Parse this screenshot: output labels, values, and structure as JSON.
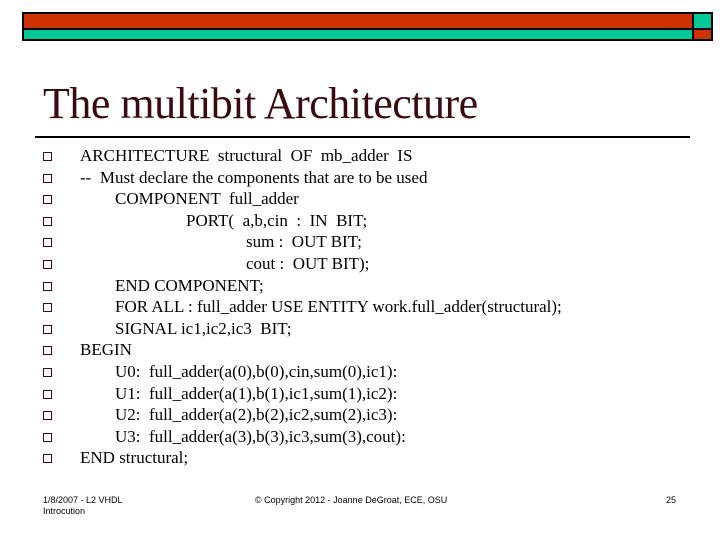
{
  "colors": {
    "accent_red": "#cc3300",
    "accent_teal": "#00c896",
    "title_color": "#3b0a10"
  },
  "slide": {
    "title": "The multibit Architecture",
    "bullet_icon": "hollow-square-icon",
    "lines": [
      {
        "indent": 0,
        "text": "ARCHITECTURE  structural  OF  mb_adder  IS"
      },
      {
        "indent": 0,
        "text": "--  Must declare the components that are to be used"
      },
      {
        "indent": 1,
        "text": "COMPONENT  full_adder"
      },
      {
        "indent": 2,
        "text": "PORT(  a,b,cin  :  IN  BIT;"
      },
      {
        "indent": 3,
        "text": "sum :  OUT BIT;"
      },
      {
        "indent": 3,
        "text": "cout :  OUT BIT);"
      },
      {
        "indent": 1,
        "text": "END COMPONENT;"
      },
      {
        "indent": 1,
        "text": "FOR ALL : full_adder USE ENTITY work.full_adder(structural);"
      },
      {
        "indent": 1,
        "text": "SIGNAL ic1,ic2,ic3  BIT;"
      },
      {
        "indent": 0,
        "text": "BEGIN"
      },
      {
        "indent": 1,
        "text": "U0:  full_adder(a(0),b(0),cin,sum(0),ic1):"
      },
      {
        "indent": 1,
        "text": "U1:  full_adder(a(1),b(1),ic1,sum(1),ic2):"
      },
      {
        "indent": 1,
        "text": "U2:  full_adder(a(2),b(2),ic2,sum(2),ic3):"
      },
      {
        "indent": 1,
        "text": "U3:  full_adder(a(3),b(3),ic3,sum(3),cout):"
      },
      {
        "indent": 0,
        "text": "END structural;"
      }
    ]
  },
  "footer": {
    "left": "1/8/2007 - L2 VHDL Introcution",
    "center": "© Copyright 2012 - Joanne DeGroat, ECE, OSU",
    "page_number": "25"
  }
}
